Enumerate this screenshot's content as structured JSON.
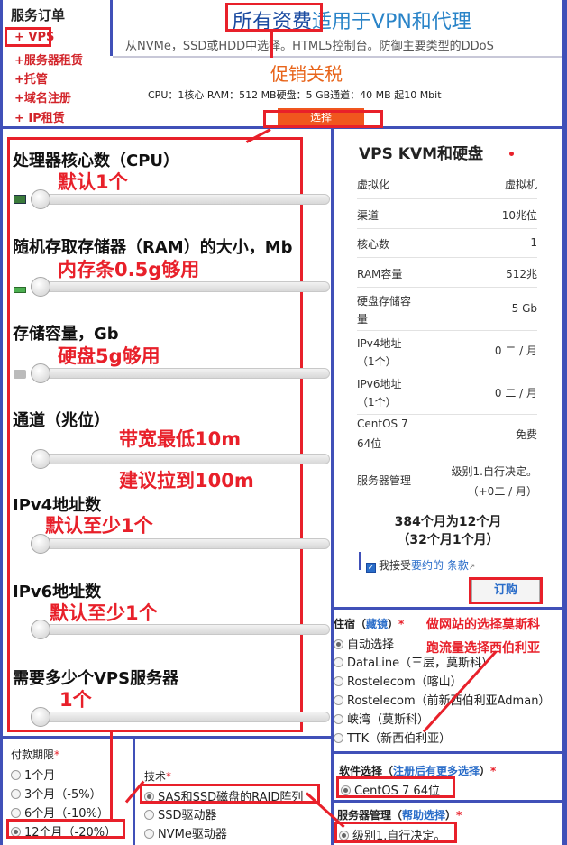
{
  "sidebar": {
    "title": "服务订单",
    "items": [
      "+ VPS",
      "+服务器租赁",
      "+托管",
      "+域名注册",
      "+ IP租赁"
    ]
  },
  "header": {
    "title_part1": "所有资费",
    "title_part2": "适用于VPN和代理",
    "subtitle": "从NVMe，SSD或HDD中选择。HTML5控制台。防御主要类型的DDoS",
    "promo": "促销关税",
    "spec": "CPU：1核心 RAM：512 MB硬盘：5 GB通道：40 MB 起10 Mbit",
    "select_button": "选择"
  },
  "sliders": [
    {
      "label": "处理器核心数（CPU）",
      "level": 0
    },
    {
      "label": "随机存取存储器（RAM）的大小，Mb",
      "level": 0
    },
    {
      "label": "存储容量，Gb",
      "level": 0
    },
    {
      "label": "通道（兆位）",
      "level": 0
    },
    {
      "label": "IPv4地址数",
      "level": 0
    },
    {
      "label": "IPv6地址数",
      "level": 0
    },
    {
      "label": "需要多少个VPS服务器",
      "level": 0
    }
  ],
  "annotations": {
    "cpu": "默认1个",
    "ram": "内存条0.5g够用",
    "disk": "硬盘5g够用",
    "bw1": "带宽最低10m",
    "bw2": "建议拉到100m",
    "ipv4": "默认至少1个",
    "ipv6": "默认至少1个",
    "count": "1个",
    "loc1": "做网站的选择莫斯科",
    "loc2": "跑流量选择西伯利亚"
  },
  "summary": {
    "title": "VPS KVM和硬盘",
    "rows": [
      {
        "k": "虚拟化",
        "v": "虚拟机"
      },
      {
        "k": "渠道",
        "v": "10兆位"
      },
      {
        "k": "核心数",
        "v": "1"
      },
      {
        "k": "RAM容量",
        "v": "512兆"
      },
      {
        "k": "硬盘存储容",
        "k2": "量",
        "v": "5 Gb"
      },
      {
        "k": "IPv4地址",
        "k2": "（1个）",
        "v": "0 二 / 月"
      },
      {
        "k": "IPv6地址",
        "k2": "（1个）",
        "v": "0 二 / 月"
      },
      {
        "k": "CentOS 7",
        "k2": "64位",
        "v": "免费"
      },
      {
        "k": "服务器管理",
        "v": "级别1.自行决定。",
        "v2": "（+0二 / 月）"
      }
    ],
    "total_line1": "384个月为12个月",
    "total_line2": "（32个月1个月）",
    "agree_text": "我接受",
    "agree_link": "要约的",
    "agree_terms": "条款",
    "order_button": "订购"
  },
  "location": {
    "header": "住宿（",
    "header_link": "藏镜",
    "header_end": "）",
    "req": "*",
    "options": [
      "自动选择",
      "DataLine（三层，莫斯科）",
      "Rostelecom（喀山）",
      "Rostelecom（前新西伯利亚Adman）",
      "峡湾（莫斯科）",
      "TTK（新西伯利亚）"
    ],
    "selected": 0
  },
  "software": {
    "header": "软件选择（",
    "header_link": "注册后有更多选择",
    "header_end": "）",
    "req": "*",
    "selected": "CentOS 7 64位"
  },
  "management": {
    "header": "服务器管理（",
    "header_link": "帮助选择",
    "header_end": "）",
    "req": "*",
    "selected": "级别1.自行决定。"
  },
  "payment": {
    "header": "付款期限",
    "req": "*",
    "options": [
      "1个月",
      "3个月（-5%）",
      "6个月（-10%）",
      "12个月（-20%）"
    ],
    "selected": 3
  },
  "tech": {
    "header": "技术",
    "req": "*",
    "options": [
      "SAS和SSD磁盘的RAID阵列",
      "SSD驱动器",
      "NVMe驱动器"
    ],
    "selected": 0
  }
}
